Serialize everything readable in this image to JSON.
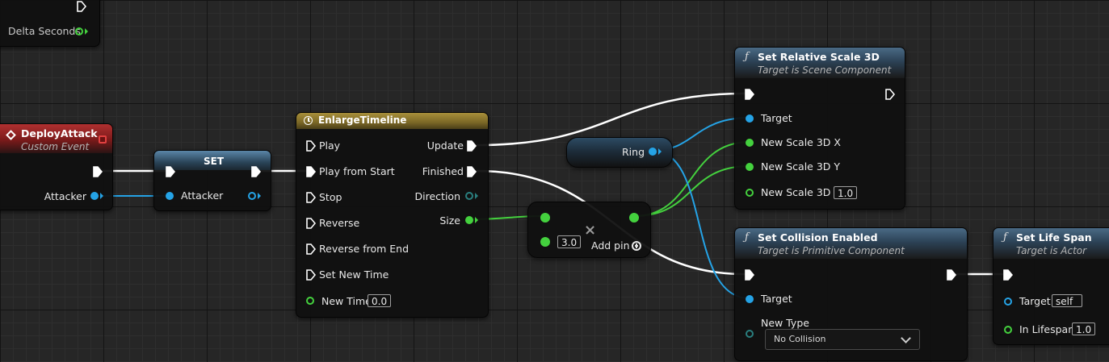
{
  "top_node": {
    "pin_label": "Delta Seconds"
  },
  "deploy_attack": {
    "title": "DeployAttack",
    "subtitle": "Custom Event",
    "attacker_label": "Attacker"
  },
  "set_node": {
    "title": "SET",
    "attacker_label": "Attacker"
  },
  "timeline": {
    "title": "EnlargeTimeline",
    "inputs": [
      "Play",
      "Play from Start",
      "Stop",
      "Reverse",
      "Reverse from End",
      "Set New Time"
    ],
    "new_time_label": "New Time",
    "new_time_value": "0.0",
    "outputs": {
      "update": "Update",
      "finished": "Finished",
      "direction": "Direction",
      "size": "Size"
    }
  },
  "ring_var": {
    "label": "Ring"
  },
  "multiply": {
    "value": "3.0",
    "add_pin": "Add pin"
  },
  "set_scale": {
    "title": "Set Relative Scale 3D",
    "subtitle": "Target is Scene Component",
    "target": "Target",
    "x": "New Scale 3D X",
    "y": "New Scale 3D Y",
    "z": "New Scale 3D Z",
    "z_value": "1.0"
  },
  "set_collision": {
    "title": "Set Collision Enabled",
    "subtitle": "Target is Primitive Component",
    "target": "Target",
    "new_type": "New Type",
    "new_type_value": "No Collision"
  },
  "set_life": {
    "title": "Set Life Span",
    "subtitle": "Target is Actor",
    "target": "Target",
    "target_value": "self",
    "lifespan": "In Lifespan",
    "lifespan_value": "1.0"
  },
  "colors": {
    "exec": "#ffffff",
    "object": "#25a3e6",
    "float": "#44d13e",
    "timeline_header": "#a88f3a",
    "event_header": "#b03030",
    "function_header": "#4a6a85"
  }
}
